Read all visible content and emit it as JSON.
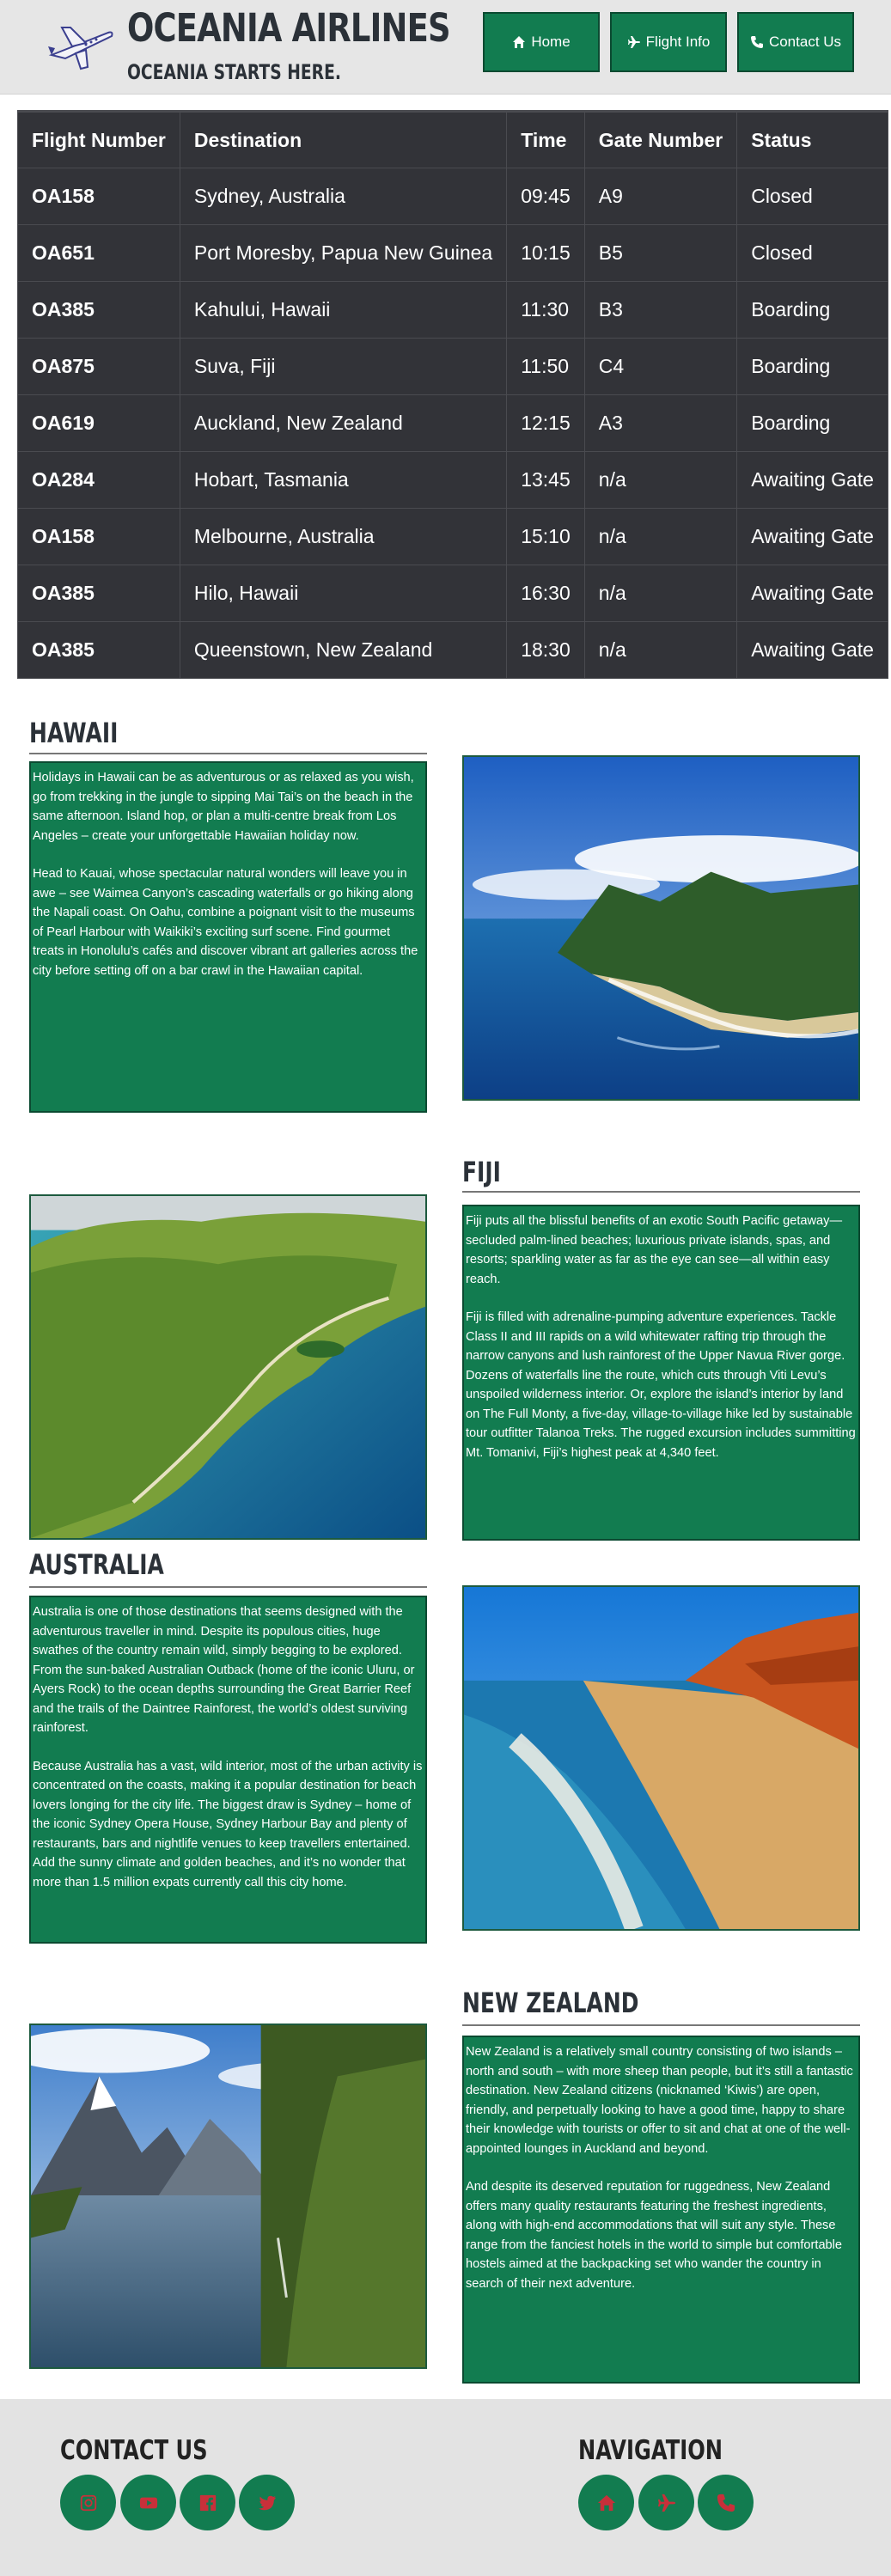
{
  "header": {
    "brand": "OCEANIA AIRLINES",
    "tagline": "OCEANIA STARTS HERE.",
    "nav": [
      {
        "label": "Home",
        "icon": "home-icon"
      },
      {
        "label": "Flight Info",
        "icon": "plane-icon"
      },
      {
        "label": "Contact Us",
        "icon": "phone-icon"
      }
    ]
  },
  "flights": {
    "columns": [
      "Flight Number",
      "Destination",
      "Time",
      "Gate Number",
      "Status"
    ],
    "rows": [
      [
        "OA158",
        "Sydney, Australia",
        "09:45",
        "A9",
        "Closed"
      ],
      [
        "OA651",
        "Port Moresby, Papua New Guinea",
        "10:15",
        "B5",
        "Closed"
      ],
      [
        "OA385",
        "Kahului, Hawaii",
        "11:30",
        "B3",
        "Boarding"
      ],
      [
        "OA875",
        "Suva, Fiji",
        "11:50",
        "C4",
        "Boarding"
      ],
      [
        "OA619",
        "Auckland, New Zealand",
        "12:15",
        "A3",
        "Boarding"
      ],
      [
        "OA284",
        "Hobart, Tasmania",
        "13:45",
        "n/a",
        "Awaiting Gate"
      ],
      [
        "OA158",
        "Melbourne, Australia",
        "15:10",
        "n/a",
        "Awaiting Gate"
      ],
      [
        "OA385",
        "Hilo, Hawaii",
        "16:30",
        "n/a",
        "Awaiting Gate"
      ],
      [
        "OA385",
        "Queenstown, New Zealand",
        "18:30",
        "n/a",
        "Awaiting Gate"
      ]
    ]
  },
  "destinations": {
    "hawaii": {
      "title": "HAWAII",
      "paragraphs": [
        "Holidays in Hawaii can be as adventurous or as relaxed as you wish, go from trekking in the jungle to sipping Mai Tai’s on the beach in the same afternoon. Island hop, or plan a multi-centre break from Los Angeles – create your unforgettable Hawaiian holiday now.",
        "Head to Kauai, whose spectacular natural wonders will leave you in awe – see Waimea Canyon’s cascading waterfalls or go hiking along the Napali coast. On Oahu, combine a poignant visit to the museums of Pearl Harbour with Waikiki’s exciting surf scene. Find gourmet treats in Honolulu’s cafés and discover vibrant art galleries across the city before setting off on a bar crawl in the Hawaiian capital."
      ]
    },
    "fiji": {
      "title": "FIJI",
      "paragraphs": [
        "Fiji puts all the blissful benefits of an exotic South Pacific getaway—secluded palm-lined beaches; luxurious private islands, spas, and resorts; sparkling water as far as the eye can see—all within easy reach.",
        "Fiji is filled with adrenaline-pumping adventure experiences. Tackle Class II and III rapids on a wild whitewater rafting trip through the narrow canyons and lush rainforest of the Upper Navua River gorge. Dozens of waterfalls line the route, which cuts through Viti Levu’s unspoiled wilderness interior. Or, explore the island’s interior by land on The Full Monty, a five-day, village-to-village hike led by sustainable tour outfitter Talanoa Treks. The rugged excursion includes summitting Mt. Tomanivi, Fiji’s highest peak at 4,340 feet."
      ]
    },
    "australia": {
      "title": "AUSTRALIA",
      "paragraphs": [
        "Australia is one of those destinations that seems designed with the adventurous traveller in mind. Despite its populous cities, huge swathes of the country remain wild, simply begging to be explored. From the sun-baked Australian Outback (home of the iconic Uluru, or Ayers Rock) to the ocean depths surrounding the Great Barrier Reef and the trails of the Daintree Rainforest, the world’s oldest surviving rainforest.",
        "Because Australia has a vast, wild interior, most of the urban activity is concentrated on the coasts, making it a popular destination for beach lovers longing for the city life. The biggest draw is Sydney – home of the iconic Sydney Opera House, Sydney Harbour Bay and plenty of restaurants, bars and nightlife venues to keep travellers entertained. Add the sunny climate and golden beaches, and it’s no wonder that more than 1.5 million expats currently call this city home."
      ]
    },
    "newzealand": {
      "title": "NEW ZEALAND",
      "paragraphs": [
        "New Zealand is a relatively small country consisting of two islands – north and south – with more sheep than people, but it’s still a fantastic destination. New Zealand citizens (nicknamed ‘Kiwis’) are open, friendly, and perpetually looking to have a good time, happy to share their knowledge with tourists or offer to sit and chat at one of the well-appointed lounges in Auckland and beyond.",
        "And despite its deserved reputation for ruggedness, New Zealand offers many quality restaurants featuring the freshest ingredients, along with high-end accommodations that will suit any style. These range from the fanciest hotels in the world to simple but comfortable hostels aimed at the backpacking set who wander the country in search of their next adventure."
      ]
    }
  },
  "footer": {
    "contact_title": "CONTACT US",
    "nav_title": "NAVIGATION",
    "social_icons": [
      "instagram-icon",
      "youtube-icon",
      "facebook-icon",
      "twitter-icon"
    ],
    "nav_icons": [
      "home-icon",
      "plane-icon",
      "phone-icon"
    ]
  },
  "colors": {
    "accent_green": "#127c50",
    "table_bg": "#323338",
    "footer_icon_red": "#c8303a",
    "header_bg": "#e6e6e6"
  }
}
